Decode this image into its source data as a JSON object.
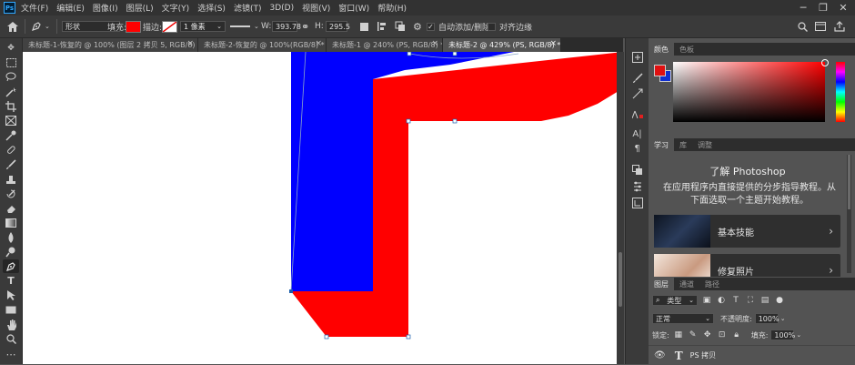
{
  "app": {
    "logo": "Ps"
  },
  "menu": [
    "文件(F)",
    "编辑(E)",
    "图像(I)",
    "图层(L)",
    "文字(Y)",
    "选择(S)",
    "滤镜(T)",
    "3D(D)",
    "视图(V)",
    "窗口(W)",
    "帮助(H)"
  ],
  "window_controls": {
    "minimize": "─",
    "restore": "❐",
    "close": "✕"
  },
  "options": {
    "mode_value": "形状",
    "fill_label": "填充:",
    "fill_color": "#ff0000",
    "stroke_label": "描边:",
    "stroke_width_value": "1 像素",
    "w_label": "W:",
    "w_value": "393.78",
    "link_icon": "⚭",
    "h_label": "H:",
    "h_value": "295.5",
    "auto_add_delete_label": "自动添加/删除",
    "auto_add_delete_checked": true,
    "align_edges_label": "对齐边缘",
    "align_edges_checked": false
  },
  "tabs": [
    {
      "label": "未标题-1-恢复的 @ 100% (图层 2 拷贝 5, RGB/8) *",
      "active": false
    },
    {
      "label": "未标题-2-恢复的 @ 100%(RGB/8) *",
      "active": false
    },
    {
      "label": "未标题-1 @ 240% (PS, RGB/8) *",
      "active": false
    },
    {
      "label": "未标题-2 @ 429% (PS, RGB/8) *",
      "active": true
    }
  ],
  "color_panel": {
    "tabs": [
      "颜色",
      "色板"
    ],
    "foreground": "#e01010",
    "background": "#1030d0"
  },
  "learn_panel": {
    "tabs": [
      "学习",
      "库",
      "调整"
    ],
    "title": "了解 Photoshop",
    "description": "在应用程序内直接提供的分步指导教程。从下面选取一个主题开始教程。",
    "cards": [
      {
        "label": "基本技能"
      },
      {
        "label": "修复照片"
      }
    ]
  },
  "layers_panel": {
    "tabs": [
      "图层",
      "通道",
      "路径"
    ],
    "filter_value": "类型",
    "blend_mode": "正常",
    "opacity_label": "不透明度:",
    "opacity_value": "100%",
    "lock_label": "锁定:",
    "fill_label": "填充:",
    "fill_value": "100%",
    "layer_name": "PS 拷贝"
  }
}
